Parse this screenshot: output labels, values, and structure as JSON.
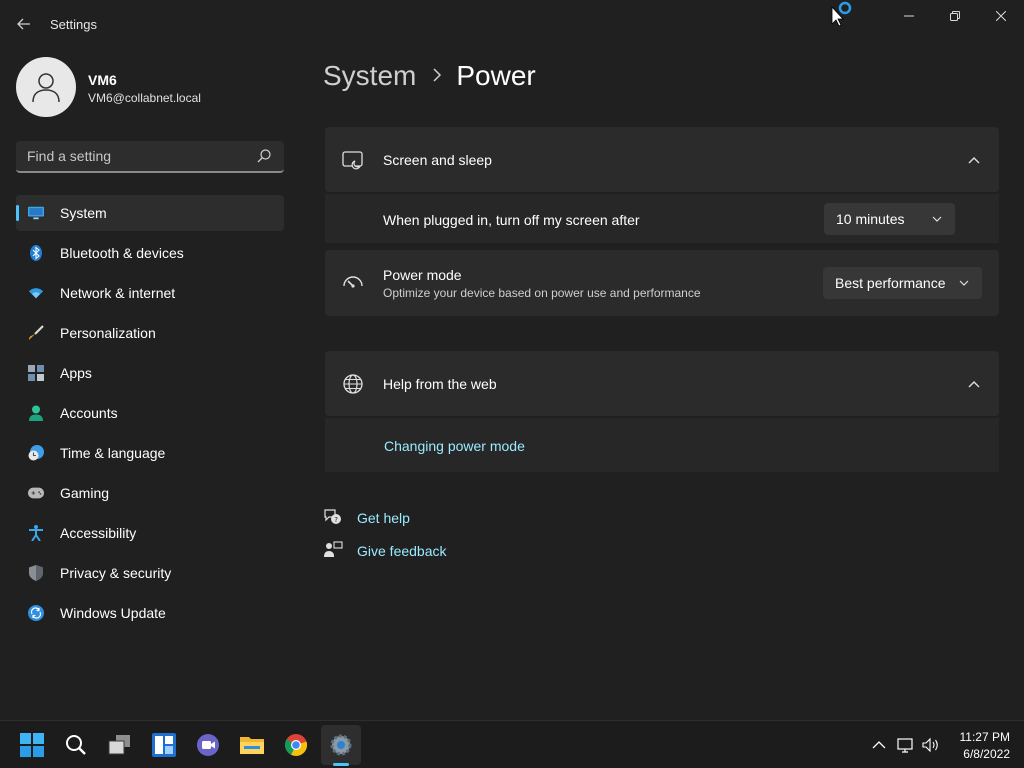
{
  "window": {
    "title": "Settings"
  },
  "user": {
    "name": "VM6",
    "email": "VM6@collabnet.local"
  },
  "search": {
    "placeholder": "Find a setting",
    "value": ""
  },
  "sidebar": {
    "items": [
      {
        "label": "System",
        "icon": "system-icon",
        "active": true
      },
      {
        "label": "Bluetooth & devices",
        "icon": "bluetooth-icon"
      },
      {
        "label": "Network & internet",
        "icon": "wifi-icon"
      },
      {
        "label": "Personalization",
        "icon": "brush-icon"
      },
      {
        "label": "Apps",
        "icon": "apps-icon"
      },
      {
        "label": "Accounts",
        "icon": "person-icon"
      },
      {
        "label": "Time & language",
        "icon": "clock-globe-icon"
      },
      {
        "label": "Gaming",
        "icon": "gamepad-icon"
      },
      {
        "label": "Accessibility",
        "icon": "accessibility-icon"
      },
      {
        "label": "Privacy & security",
        "icon": "shield-icon"
      },
      {
        "label": "Windows Update",
        "icon": "update-icon"
      }
    ]
  },
  "breadcrumb": {
    "parent": "System",
    "current": "Power"
  },
  "screen_sleep": {
    "title": "Screen and sleep",
    "setting_label": "When plugged in, turn off my screen after",
    "setting_value": "10 minutes"
  },
  "power_mode": {
    "title": "Power mode",
    "description": "Optimize your device based on power use and performance",
    "value": "Best performance"
  },
  "help_web": {
    "title": "Help from the web",
    "link": "Changing power mode"
  },
  "footer_links": {
    "get_help": "Get help",
    "give_feedback": "Give feedback"
  },
  "taskbar": {
    "time": "11:27 PM",
    "date": "6/8/2022"
  },
  "colors": {
    "accent": "#4cc2ff",
    "link": "#99ebff",
    "background": "#202020",
    "card": "#2b2b2b"
  }
}
